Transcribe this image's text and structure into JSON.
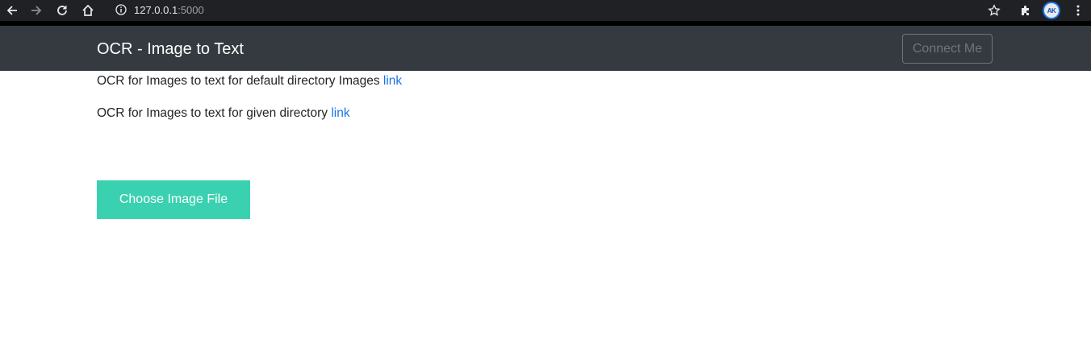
{
  "browser": {
    "url_host": "127.0.0.1",
    "url_port": ":5000",
    "profile_initials": "AK"
  },
  "navbar": {
    "brand": "OCR - Image to Text",
    "connect_label": "Connect Me"
  },
  "content": {
    "line1_text": "OCR for Images to text for default directory Images ",
    "line1_link": "link",
    "line2_text": "OCR for Images to text for given directory ",
    "line2_link": "link",
    "choose_file_label": "Choose Image File"
  },
  "colors": {
    "navbar_bg": "#343a40",
    "accent_button": "#3ad1b1",
    "link": "#1a73e8"
  }
}
